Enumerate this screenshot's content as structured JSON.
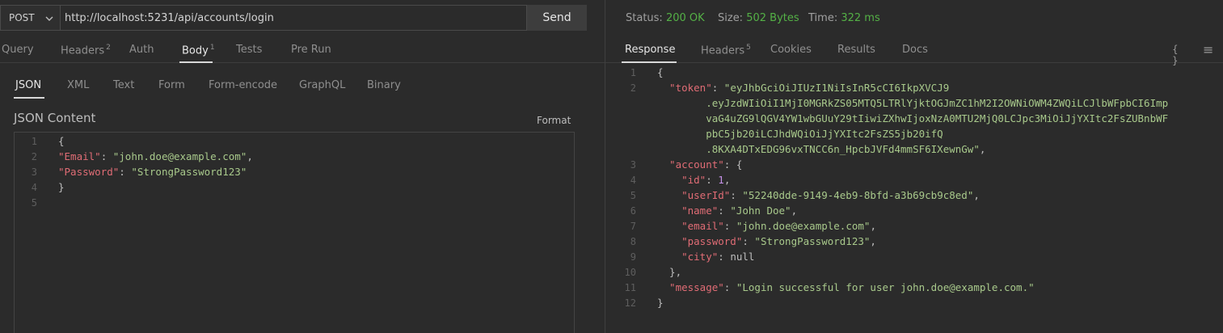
{
  "request": {
    "method": "POST",
    "url": "http://localhost:5231/api/accounts/login",
    "send_label": "Send"
  },
  "request_tabs": [
    {
      "label": "Query"
    },
    {
      "label": "Headers",
      "badge": "2"
    },
    {
      "label": "Auth"
    },
    {
      "label": "Body",
      "badge": "1",
      "active": true
    },
    {
      "label": "Tests"
    },
    {
      "label": "Pre Run"
    }
  ],
  "body_tabs": [
    {
      "label": "JSON",
      "active": true
    },
    {
      "label": "XML"
    },
    {
      "label": "Text"
    },
    {
      "label": "Form"
    },
    {
      "label": "Form-encode"
    },
    {
      "label": "GraphQL"
    },
    {
      "label": "Binary"
    }
  ],
  "json_content": {
    "title": "JSON Content",
    "format_label": "Format",
    "line_numbers": [
      "1",
      "2",
      "3",
      "4",
      "5"
    ],
    "lines": [
      [
        {
          "t": "p",
          "v": "{"
        }
      ],
      [
        {
          "t": "k",
          "v": "\"Email\""
        },
        {
          "t": "p",
          "v": ": "
        },
        {
          "t": "s",
          "v": "\"john.doe@example.com\""
        },
        {
          "t": "p",
          "v": ","
        }
      ],
      [
        {
          "t": "k",
          "v": "\"Password\""
        },
        {
          "t": "p",
          "v": ": "
        },
        {
          "t": "s",
          "v": "\"StrongPassword123\""
        }
      ],
      [
        {
          "t": "p",
          "v": "}"
        }
      ],
      []
    ]
  },
  "response_status": {
    "status_label": "Status:",
    "status_value": "200 OK",
    "size_label": "Size:",
    "size_value": "502 Bytes",
    "time_label": "Time:",
    "time_value": "322 ms"
  },
  "response_tabs": [
    {
      "label": "Response",
      "active": true
    },
    {
      "label": "Headers",
      "badge": "5"
    },
    {
      "label": "Cookies"
    },
    {
      "label": "Results"
    },
    {
      "label": "Docs"
    }
  ],
  "response_icons": {
    "braces": "{ }",
    "menu": "≡"
  },
  "response_body": {
    "line_numbers": [
      "1",
      "2",
      "",
      "",
      "",
      "",
      "3",
      "4",
      "5",
      "6",
      "7",
      "8",
      "9",
      "10",
      "11",
      "12"
    ],
    "lines": [
      [
        {
          "t": "p",
          "v": "{"
        }
      ],
      [
        {
          "t": "k",
          "v": "  \"token\""
        },
        {
          "t": "p",
          "v": ": "
        },
        {
          "t": "s",
          "v": "\"eyJhbGciOiJIUzI1NiIsInR5cCI6IkpXVCJ9"
        }
      ],
      [
        {
          "t": "s",
          "v": "        .eyJzdWIiOiI1MjI0MGRkZS05MTQ5LTRlYjktOGJmZC1hM2I2OWNiOWM4ZWQiLCJlbWFpbCI6Imp"
        }
      ],
      [
        {
          "t": "s",
          "v": "        vaG4uZG9lQGV4YW1wbGUuY29tIiwiZXhwIjoxNzA0MTU2MjQ0LCJpc3MiOiJjYXItc2FsZUBnbWF"
        }
      ],
      [
        {
          "t": "s",
          "v": "        pbC5jb20iLCJhdWQiOiJjYXItc2FsZS5jb20ifQ"
        }
      ],
      [
        {
          "t": "s",
          "v": "        .8KXA4DTxEDG96vxTNCC6n_HpcbJVFd4mmSF6IXewnGw\""
        },
        {
          "t": "p",
          "v": ","
        }
      ],
      [
        {
          "t": "k",
          "v": "  \"account\""
        },
        {
          "t": "p",
          "v": ": {"
        }
      ],
      [
        {
          "t": "k",
          "v": "    \"id\""
        },
        {
          "t": "p",
          "v": ": "
        },
        {
          "t": "n",
          "v": "1"
        },
        {
          "t": "p",
          "v": ","
        }
      ],
      [
        {
          "t": "k",
          "v": "    \"userId\""
        },
        {
          "t": "p",
          "v": ": "
        },
        {
          "t": "s",
          "v": "\"52240dde-9149-4eb9-8bfd-a3b69cb9c8ed\""
        },
        {
          "t": "p",
          "v": ","
        }
      ],
      [
        {
          "t": "k",
          "v": "    \"name\""
        },
        {
          "t": "p",
          "v": ": "
        },
        {
          "t": "s",
          "v": "\"John Doe\""
        },
        {
          "t": "p",
          "v": ","
        }
      ],
      [
        {
          "t": "k",
          "v": "    \"email\""
        },
        {
          "t": "p",
          "v": ": "
        },
        {
          "t": "s",
          "v": "\"john.doe@example.com\""
        },
        {
          "t": "p",
          "v": ","
        }
      ],
      [
        {
          "t": "k",
          "v": "    \"password\""
        },
        {
          "t": "p",
          "v": ": "
        },
        {
          "t": "s",
          "v": "\"StrongPassword123\""
        },
        {
          "t": "p",
          "v": ","
        }
      ],
      [
        {
          "t": "k",
          "v": "    \"city\""
        },
        {
          "t": "p",
          "v": ": "
        },
        {
          "t": "nl",
          "v": "null"
        }
      ],
      [
        {
          "t": "p",
          "v": "  },"
        }
      ],
      [
        {
          "t": "k",
          "v": "  \"message\""
        },
        {
          "t": "p",
          "v": ": "
        },
        {
          "t": "s",
          "v": "\"Login successful for user john.doe@example.com.\""
        }
      ],
      [
        {
          "t": "p",
          "v": "}"
        }
      ]
    ]
  }
}
